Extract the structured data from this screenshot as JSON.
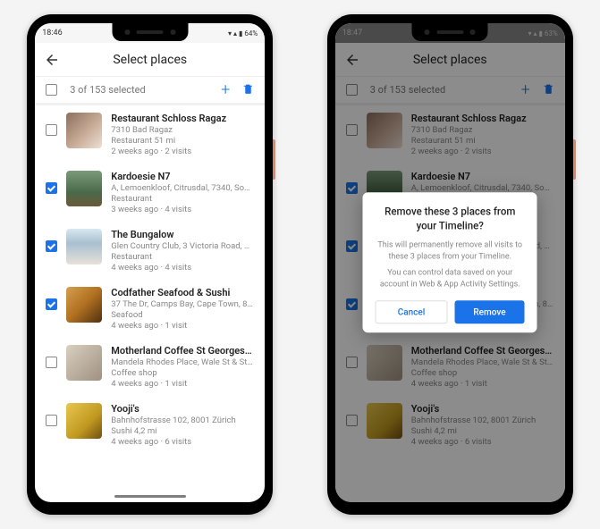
{
  "phone_left": {
    "status": {
      "time": "18:46",
      "battery": "64%"
    },
    "header": {
      "title": "Select places"
    },
    "selection": {
      "count_text": "3 of 153 selected"
    },
    "places": [
      {
        "name": "Restaurant Schloss Ragaz",
        "addr": "7310 Bad Ragaz",
        "type": "Restaurant 51 mi",
        "meta": "2 weeks ago · 2 visits",
        "checked": false,
        "thumb": "th-1"
      },
      {
        "name": "Kardoesie N7",
        "addr": "A, Lemoenkloof, Citrusdal, 7340, Sout…",
        "type": "Restaurant",
        "meta": "3 weeks ago · 4 visits",
        "checked": true,
        "thumb": "th-2"
      },
      {
        "name": "The Bungalow",
        "addr": "Glen Country Club, 3 Victoria Road, Cli…",
        "type": "Restaurant",
        "meta": "4 weeks ago · 4 visits",
        "checked": true,
        "thumb": "th-3"
      },
      {
        "name": "Codfather Seafood & Sushi",
        "addr": "37 The Dr, Camps Bay, Cape Town, 80…",
        "type": "Seafood",
        "meta": "4 weeks ago · 1 visit",
        "checked": true,
        "thumb": "th-4"
      },
      {
        "name": "Motherland Coffee St Georges…",
        "addr": "Mandela Rhodes Place, Wale St & St G…",
        "type": "Coffee shop",
        "meta": "4 weeks ago · 1 visit",
        "checked": false,
        "thumb": "th-5"
      },
      {
        "name": "Yooji's",
        "addr": "Bahnhofstrasse 102, 8001 Zürich",
        "type": "Sushi 4,2 mi",
        "meta": "4 weeks ago · 6 visits",
        "checked": false,
        "thumb": "th-6"
      }
    ]
  },
  "phone_right": {
    "status": {
      "time": "18:47",
      "battery": "63%"
    },
    "header": {
      "title": "Select places"
    },
    "selection": {
      "count_text": "3 of 153 selected"
    },
    "dialog": {
      "title": "Remove these 3 places from your Timeline?",
      "body1": "This will permanently remove all visits to these 3 places from your Timeline.",
      "body2": "You can control data saved on your account in Web & App Activity Settings.",
      "cancel": "Cancel",
      "confirm": "Remove"
    }
  }
}
